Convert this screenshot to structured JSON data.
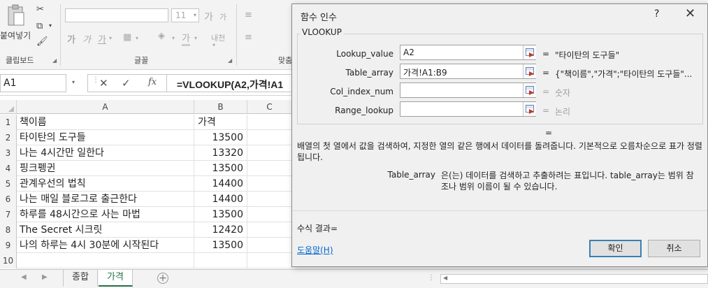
{
  "ribbon": {
    "paste_label": "붙여넣기",
    "clipboard_label": "클립보드",
    "font_size": "11",
    "font_size_up": "가",
    "font_size_down": "가",
    "bold": "가",
    "italic": "가",
    "underline": "가",
    "font_color": "가",
    "phonetic": "내천",
    "font_group_label": "글꼴",
    "align_group_label": "맞춤"
  },
  "formula_bar": {
    "name_box": "A1",
    "fx": "fx",
    "formula": "=VLOOKUP(A2,가격!A1"
  },
  "columns": [
    "A",
    "B",
    "C"
  ],
  "rows": [
    {
      "num": "1",
      "a": "책이름",
      "b": "가격"
    },
    {
      "num": "2",
      "a": "타이탄의 도구들",
      "b": "13500"
    },
    {
      "num": "3",
      "a": "나는 4시간만 일한다",
      "b": "13320"
    },
    {
      "num": "4",
      "a": "핑크펭귄",
      "b": "13500"
    },
    {
      "num": "5",
      "a": "관계우선의 법칙",
      "b": "14400"
    },
    {
      "num": "6",
      "a": "나는 매일 블로그로 출근한다",
      "b": "14400"
    },
    {
      "num": "7",
      "a": "하루를 48시간으로 사는 마법",
      "b": "13500"
    },
    {
      "num": "8",
      "a": "The Secret 시크릿",
      "b": "12420"
    },
    {
      "num": "9",
      "a": "나의 하루는 4시 30분에 시작된다",
      "b": "13500"
    },
    {
      "num": "10",
      "a": "",
      "b": ""
    }
  ],
  "sheet_tabs": [
    "종합",
    "가격"
  ],
  "active_tab_index": 1,
  "accent_color": "#217346",
  "dialog": {
    "title": "함수 인수",
    "help_glyph": "?",
    "close_glyph": "✕",
    "function_name": "VLOOKUP",
    "args": [
      {
        "label": "Lookup_value",
        "value": "A2",
        "result": "\"타이탄의 도구들\""
      },
      {
        "label": "Table_array",
        "value": "가격!A1:B9",
        "result": "{\"책이름\",\"가격\";\"타이탄의 도구들\"..."
      },
      {
        "label": "Col_index_num",
        "value": "",
        "result": "숫자"
      },
      {
        "label": "Range_lookup",
        "value": "",
        "result": "논리"
      }
    ],
    "equals": "=",
    "main_equals": "=",
    "description": "배열의 첫 열에서 값을 검색하여, 지정한 열의 같은 행에서 데이터를 돌려줍니다. 기본적으로 오름차순으로 표가 정렬됩니다.",
    "arg_desc_name": "Table_array",
    "arg_desc_text": "은(는) 데이터를 검색하고 추출하려는 표입니다. table_array는 범위 참조나 범위 이름이 될 수 있습니다.",
    "result_label": "수식 결과=",
    "help_link": "도움말(H)",
    "ok_label": "확인",
    "cancel_label": "취소"
  }
}
